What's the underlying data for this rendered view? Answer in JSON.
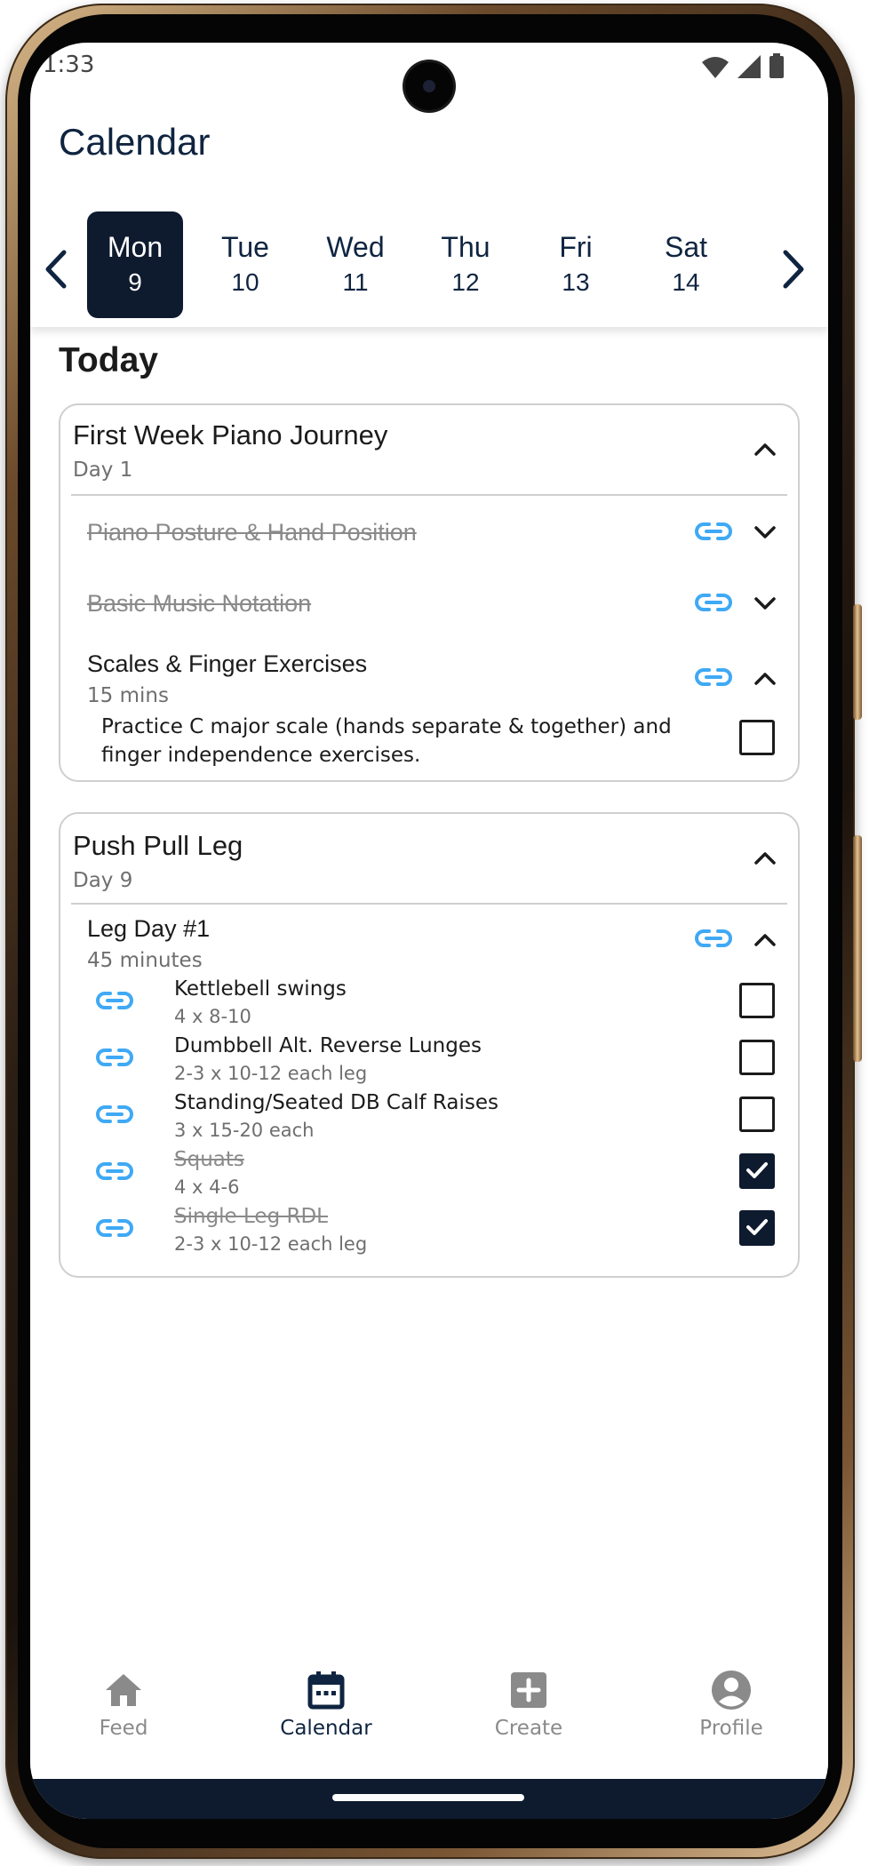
{
  "status_bar": {
    "time": "1:33"
  },
  "header": {
    "title": "Calendar"
  },
  "week": {
    "days": [
      {
        "name": "Mon",
        "num": "9"
      },
      {
        "name": "Tue",
        "num": "10"
      },
      {
        "name": "Wed",
        "num": "11"
      },
      {
        "name": "Thu",
        "num": "12"
      },
      {
        "name": "Fri",
        "num": "13"
      },
      {
        "name": "Sat",
        "num": "14"
      }
    ],
    "selected": "Mon"
  },
  "section_title": "Today",
  "cards": [
    {
      "title": "First Week Piano Journey",
      "subtitle": "Day 1",
      "items": [
        {
          "title": "Piano Posture & Hand Position",
          "done": true
        },
        {
          "title": "Basic Music Notation",
          "done": true
        },
        {
          "title": "Scales & Finger Exercises",
          "duration": "15 mins",
          "description": "Practice C major scale (hands separate & together) and finger independence exercises.",
          "checked": false
        }
      ]
    },
    {
      "title": "Push Pull Leg",
      "subtitle": "Day 9",
      "workout": {
        "title": "Leg Day #1",
        "duration": "45 minutes",
        "exercises": [
          {
            "name": "Kettlebell swings",
            "sets": "4 x 8-10",
            "checked": false
          },
          {
            "name": "Dumbbell Alt. Reverse Lunges",
            "sets": "2-3 x 10-12 each leg",
            "checked": false
          },
          {
            "name": "Standing/Seated DB Calf Raises",
            "sets": "3 x 15-20 each",
            "checked": false
          },
          {
            "name": "Squats",
            "sets": "4 x 4-6",
            "checked": true
          },
          {
            "name": "Single Leg RDL",
            "sets": "2-3 x 10-12 each leg",
            "checked": true
          }
        ]
      }
    }
  ],
  "bottom_nav": {
    "items": [
      {
        "label": "Feed",
        "icon": "home-icon"
      },
      {
        "label": "Calendar",
        "icon": "calendar-icon"
      },
      {
        "label": "Create",
        "icon": "add-box-icon"
      },
      {
        "label": "Profile",
        "icon": "account-circle-icon"
      }
    ],
    "active": "Calendar"
  },
  "colors": {
    "primary_dark": "#0e1a2e",
    "link_blue": "#3fa9f5",
    "muted_text": "#8a8a8a"
  }
}
